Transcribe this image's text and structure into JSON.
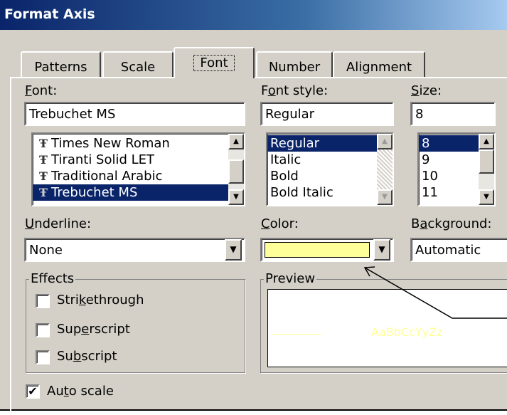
{
  "title": "Format Axis",
  "tabs": [
    "Patterns",
    "Scale",
    "Font",
    "Number",
    "Alignment"
  ],
  "font": {
    "label_key": "F",
    "label_rest": "ont:",
    "value": "Trebuchet MS",
    "items": [
      "Times New Roman",
      "Tiranti Solid LET",
      "Traditional Arabic",
      "Trebuchet MS"
    ],
    "selected": "Trebuchet MS",
    "icon": "truetype-font-icon",
    "icon_glyph": "Ŧ"
  },
  "font_style": {
    "label_pre": "F",
    "label_key": "o",
    "label_rest": "nt style:",
    "value": "Regular",
    "items": [
      "Regular",
      "Italic",
      "Bold",
      "Bold Italic"
    ],
    "selected": "Regular"
  },
  "size": {
    "label_key": "S",
    "label_rest": "ize:",
    "value": "8",
    "items": [
      "8",
      "9",
      "10",
      "11"
    ],
    "selected": "8"
  },
  "underline": {
    "label_key": "U",
    "label_rest": "nderline:",
    "value": "None"
  },
  "color": {
    "label_key": "C",
    "label_rest": "olor:",
    "swatch": "#ffff99"
  },
  "background": {
    "label_pre": "B",
    "label_key": "a",
    "label_rest": "ckground:",
    "value": "Automatic"
  },
  "effects": {
    "title": "Effects",
    "strike": {
      "pre": "Stri",
      "key": "k",
      "post": "ethrough",
      "checked": false
    },
    "superscript": {
      "pre": "Sup",
      "key": "e",
      "post": "rscript",
      "checked": false
    },
    "subscript": {
      "pre": "Su",
      "key": "b",
      "post": "script",
      "checked": false
    }
  },
  "preview": {
    "title": "Preview",
    "text": "AaBbCcYyZz",
    "text_color": "#ffff99"
  },
  "autoscale": {
    "pre": "Au",
    "key": "t",
    "post": "o scale",
    "checked": true,
    "mark": "✔"
  },
  "icons": {
    "up": "▲",
    "down": "▼"
  },
  "colors": {
    "title_start": "#0a246a",
    "selection": "#0a246a",
    "face": "#d4d0c8"
  }
}
